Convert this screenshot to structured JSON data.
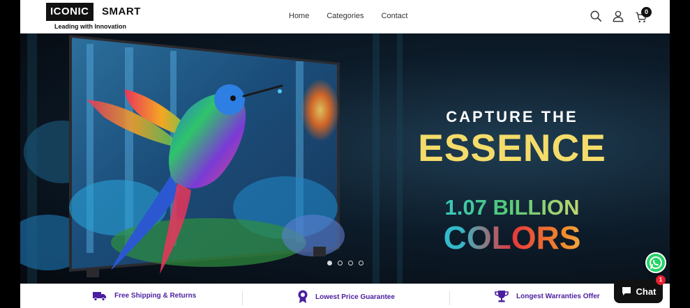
{
  "brand": {
    "name_boxed": "ICONIC",
    "name_plain": "SMART",
    "tagline": "Leading with Innovation"
  },
  "nav": {
    "items": [
      "Home",
      "Categories",
      "Contact"
    ]
  },
  "header_icons": [
    "search-icon",
    "account-icon",
    "cart-icon"
  ],
  "cart": {
    "count": "0"
  },
  "hero": {
    "line1": "CAPTURE THE",
    "line2": "ESSENCE",
    "line3": "1.07 BILLION",
    "line4": "COLORS",
    "slides_total": 4,
    "active_slide": 1,
    "colors": {
      "accent_yellow": "#f4dc6a",
      "bg_dark": "#0d1c2a"
    }
  },
  "features": [
    {
      "label": "Free Shipping & Returns",
      "icon": "truck-icon"
    },
    {
      "label": "Lowest Price Guarantee",
      "icon": "award-badge-icon"
    },
    {
      "label": "Longest Warranties Offer",
      "icon": "trophy-icon"
    }
  ],
  "feature_color": "#4b1fa0",
  "chat": {
    "label": "Chat",
    "badge": "1"
  }
}
